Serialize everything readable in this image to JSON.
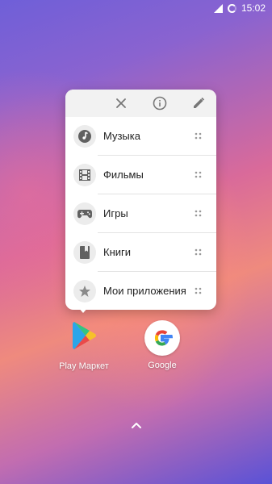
{
  "status_bar": {
    "time": "15:02"
  },
  "shortcuts_popup": {
    "header_icons": [
      "close-icon",
      "info-icon",
      "edit-icon"
    ],
    "items": [
      {
        "label": "Музыка",
        "icon": "music-note-icon"
      },
      {
        "label": "Фильмы",
        "icon": "film-icon"
      },
      {
        "label": "Игры",
        "icon": "gamepad-icon"
      },
      {
        "label": "Книги",
        "icon": "book-icon"
      },
      {
        "label": "Мои приложения",
        "icon": "star-icon"
      }
    ]
  },
  "home_apps": [
    {
      "label": "Play Маркет",
      "icon": "play-store-icon"
    },
    {
      "label": "Google",
      "icon": "google-icon"
    }
  ],
  "colors": {
    "icon_gray": "#616161",
    "popup_header_bg": "#f2f2f2"
  }
}
